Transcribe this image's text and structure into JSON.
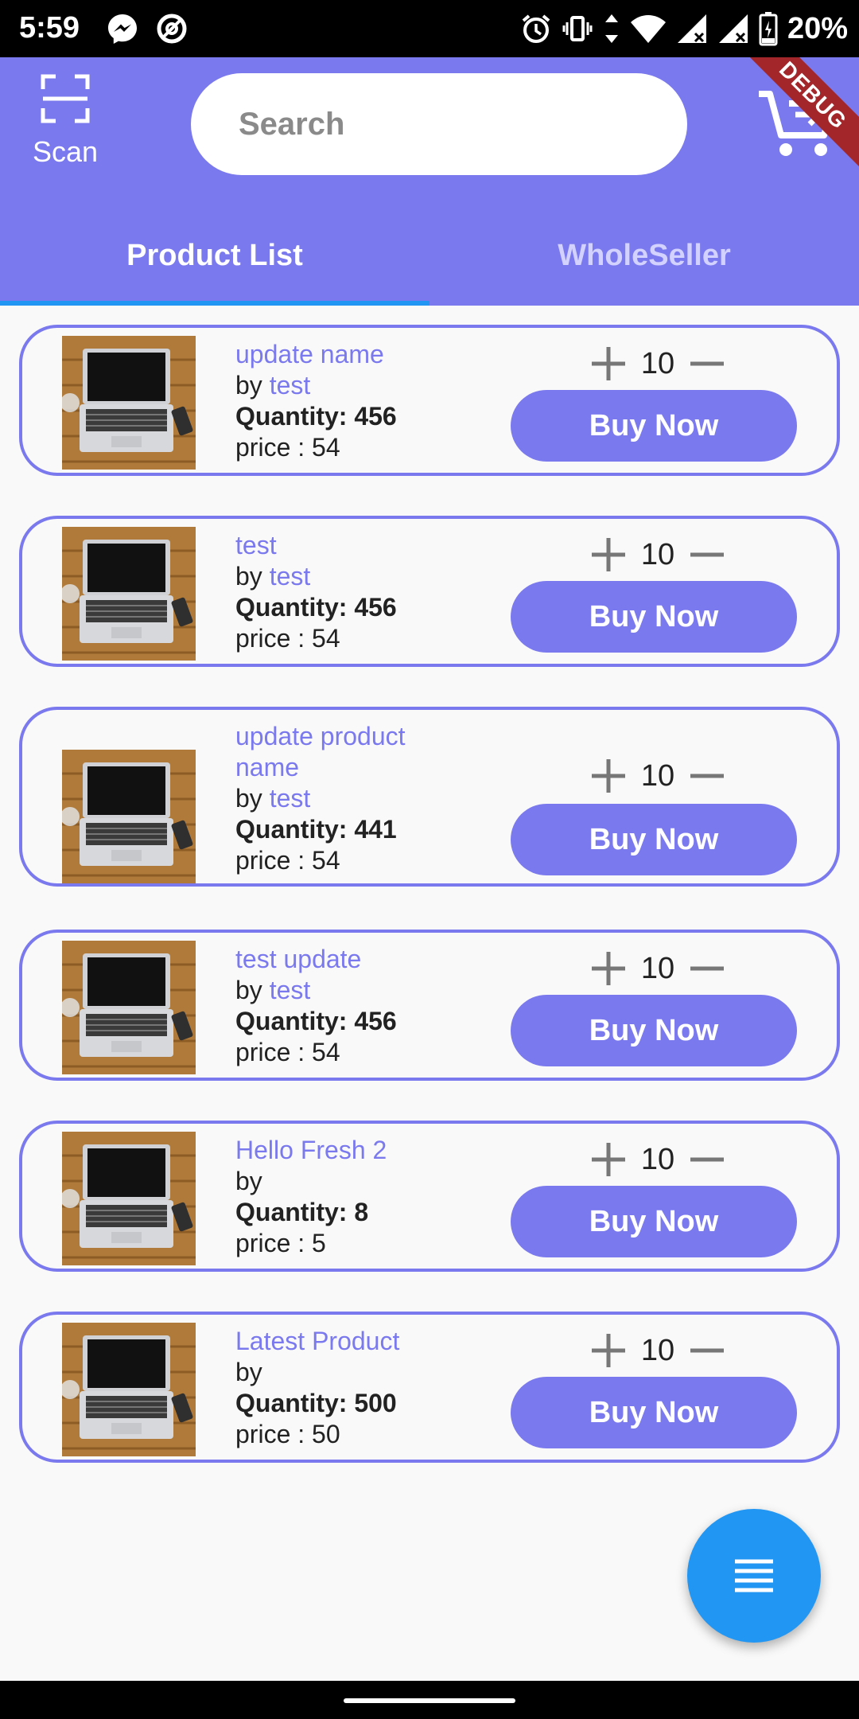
{
  "status_bar": {
    "time": "5:59",
    "battery_percent": "20%",
    "icons": [
      "messenger-icon",
      "app-icon",
      "alarm-icon",
      "vibrate-icon",
      "data-arrows-icon",
      "wifi-icon",
      "signal-icon",
      "signal-icon",
      "battery-charging-icon"
    ]
  },
  "app_bar": {
    "scan_label": "Scan",
    "search_placeholder": "Search",
    "debug_banner": "DEBUG",
    "accent_color": "#7b79ee"
  },
  "tabs": [
    {
      "label": "Product List",
      "selected": true
    },
    {
      "label": "WholeSeller",
      "selected": false
    }
  ],
  "products": [
    {
      "name": "update name",
      "by_label": "by",
      "seller": "test",
      "quantity": "Quantity: 456",
      "price": "price : 54",
      "count": "10",
      "buy_label": "Buy Now"
    },
    {
      "name": "test",
      "by_label": "by",
      "seller": "test",
      "quantity": "Quantity: 456",
      "price": "price : 54",
      "count": "10",
      "buy_label": "Buy Now"
    },
    {
      "name": "update product name",
      "by_label": "by",
      "seller": "test",
      "quantity": "Quantity: 441",
      "price": "price : 54",
      "count": "10",
      "buy_label": "Buy Now"
    },
    {
      "name": "test update",
      "by_label": "by",
      "seller": "test",
      "quantity": "Quantity: 456",
      "price": "price : 54",
      "count": "10",
      "buy_label": "Buy Now"
    },
    {
      "name": "Hello Fresh 2",
      "by_label": "by",
      "seller": "",
      "quantity": "Quantity: 8",
      "price": "price : 5",
      "count": "10",
      "buy_label": "Buy Now"
    },
    {
      "name": "Latest Product",
      "by_label": "by",
      "seller": "",
      "quantity": "Quantity: 500",
      "price": "price : 50",
      "count": "10",
      "buy_label": "Buy Now"
    }
  ],
  "fab": {
    "icon": "menu-icon",
    "color": "#2196f3"
  }
}
